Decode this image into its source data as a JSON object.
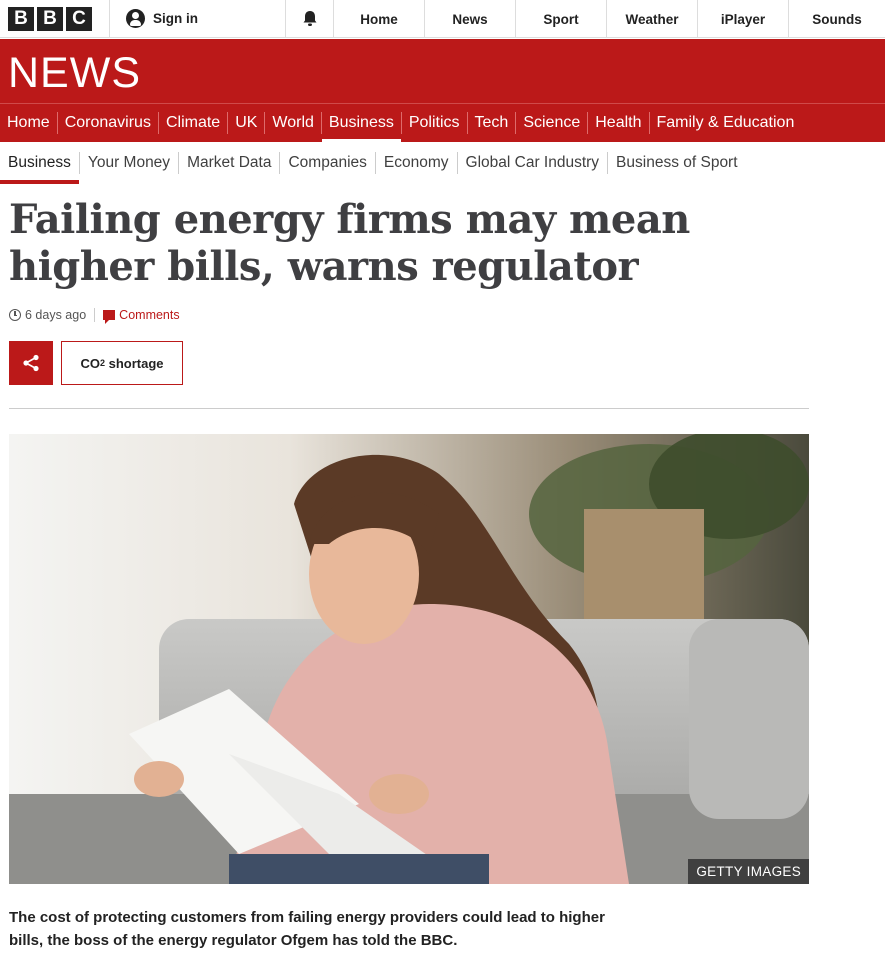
{
  "brand": {
    "logo_letters": [
      "B",
      "B",
      "C"
    ]
  },
  "topbar": {
    "signin_label": "Sign in",
    "nav": [
      "Home",
      "News",
      "Sport",
      "Weather",
      "iPlayer",
      "Sounds"
    ]
  },
  "banner": {
    "title": "NEWS"
  },
  "primary_nav": [
    {
      "label": "Home",
      "active": false
    },
    {
      "label": "Coronavirus",
      "active": false
    },
    {
      "label": "Climate",
      "active": false
    },
    {
      "label": "UK",
      "active": false
    },
    {
      "label": "World",
      "active": false
    },
    {
      "label": "Business",
      "active": true
    },
    {
      "label": "Politics",
      "active": false
    },
    {
      "label": "Tech",
      "active": false
    },
    {
      "label": "Science",
      "active": false
    },
    {
      "label": "Health",
      "active": false
    },
    {
      "label": "Family & Education",
      "active": false
    }
  ],
  "secondary_nav": [
    {
      "label": "Business",
      "active": true
    },
    {
      "label": "Your Money",
      "active": false
    },
    {
      "label": "Market Data",
      "active": false
    },
    {
      "label": "Companies",
      "active": false
    },
    {
      "label": "Economy",
      "active": false
    },
    {
      "label": "Global Car Industry",
      "active": false
    },
    {
      "label": "Business of Sport",
      "active": false
    }
  ],
  "article": {
    "headline": "Failing energy firms may mean higher bills, warns regulator",
    "timestamp": "6 days ago",
    "comments_label": "Comments",
    "tag": {
      "prefix": "CO",
      "subscript": "2",
      "suffix": " shortage"
    },
    "image_credit": "GETTY IMAGES",
    "intro": "The cost of protecting customers from failing energy providers could lead to higher bills, the boss of the energy regulator Ofgem has told the BBC."
  },
  "colors": {
    "brand_red": "#bb1919",
    "text_dark": "#222222",
    "headline": "#3f3f42"
  },
  "icons": [
    "user-icon",
    "bell-icon",
    "clock-icon",
    "comment-icon",
    "share-icon"
  ]
}
